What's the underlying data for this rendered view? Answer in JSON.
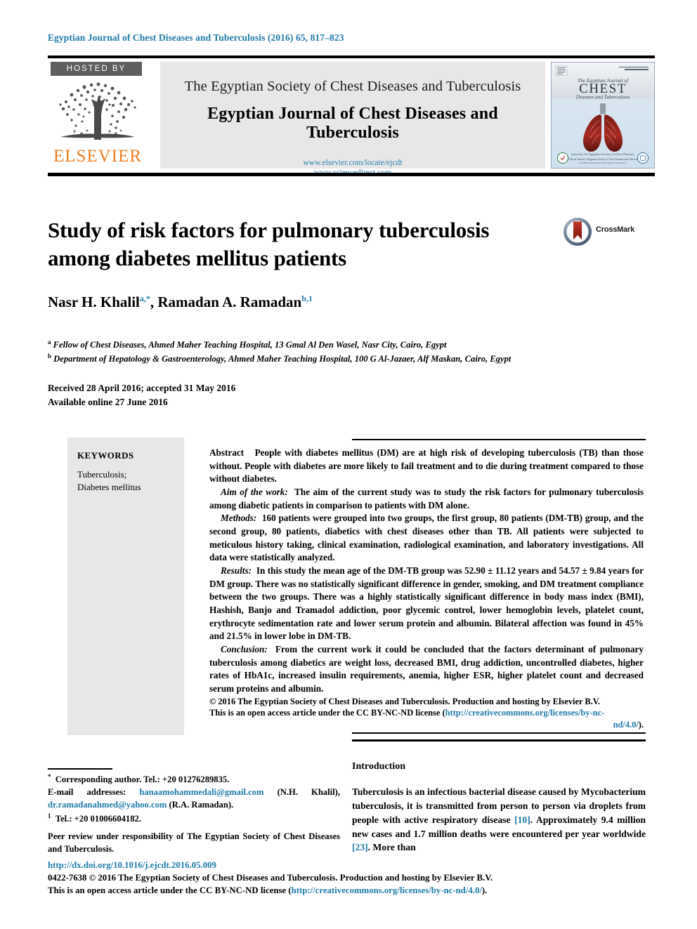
{
  "running_head": "Egyptian Journal of Chest Diseases and Tuberculosis (2016) 65, 817–823",
  "masthead": {
    "hosted_by_label": "HOSTED BY",
    "publisher_name": "ELSEVIER",
    "society_line": "The Egyptian Society of Chest Diseases and Tuberculosis",
    "journal_title": "Egyptian Journal of Chest Diseases and Tuberculosis",
    "url_elsevier": "www.elsevier.com/locate/ejcdt",
    "url_sciencedirect": "www.sciencedirect.com",
    "cover": {
      "top_right_label": "Egyptian Journal of Chest Diseases and Tuberculosis",
      "line1": "The Egyptian Journal of",
      "line2": "CHEST",
      "line3": "Diseases and Tuberculosis",
      "footer1": "Issued by the Egyptian Society of Chest Diseases and Tuberculosis",
      "footer2": "The Official Journal of Egyptian Society of Chest Diseases and Tuberculosis",
      "footer3": "An Official Journal of Arab Thoracic Association"
    }
  },
  "article": {
    "title": "Study of risk factors for pulmonary tuberculosis among diabetes mellitus patients",
    "crossmark_label": "CrossMark",
    "authors_html": "Nasr H. Khalil<sup>a,*</sup>, Ramadan A. Ramadan<sup>b,1</sup>",
    "affiliation_a": "Fellow of Chest Diseases, Ahmed Maher Teaching Hospital, 13 Gmal Al Den Wasel, Nasr City, Cairo, Egypt",
    "affiliation_b": "Department of Hepatology & Gastroenterology, Ahmed Maher Teaching Hospital, 100 G Al-Jazaer, Alf Maskan, Cairo, Egypt",
    "received_line": "Received 28 April 2016; accepted 31 May 2016",
    "available_line": "Available online 27 June 2016"
  },
  "keywords": {
    "heading": "KEYWORDS",
    "items_text": "Tuberculosis;\nDiabetes mellitus"
  },
  "abstract": {
    "label": "Abstract",
    "lead": "People with diabetes mellitus (DM) are at high risk of developing tuberculosis (TB) than those without. People with diabetes are more likely to fail treatment and to die during treatment compared to those without diabetes.",
    "aim_label": "Aim of the work:",
    "aim_text": "The aim of the current study was to study the risk factors for pulmonary tuberculosis among diabetic patients in comparison to patients with DM alone.",
    "methods_label": "Methods:",
    "methods_text": "160 patients were grouped into two groups, the first group, 80 patients (DM-TB) group, and the second group, 80 patients, diabetics with chest diseases other than TB. All patients were subjected to meticulous history taking, clinical examination, radiological examination, and laboratory investigations. All data were statistically analyzed.",
    "results_label": "Results:",
    "results_text": "In this study the mean age of the DM-TB group was 52.90 ± 11.12 years and 54.57 ± 9.84 years for DM group. There was no statistically significant difference in gender, smoking, and DM treatment compliance between the two groups. There was a highly statistically significant difference in body mass index (BMI), Hashish, Banjo and Tramadol addiction, poor glycemic control, lower hemoglobin levels, platelet count, erythrocyte sedimentation rate and lower serum protein and albumin. Bilateral affection was found in 45% and 21.5% in lower lobe in DM-TB.",
    "conclusion_label": "Conclusion:",
    "conclusion_text": "From the current work it could be concluded that the factors determinant of pulmonary tuberculosis among diabetics are weight loss, decreased BMI, drug addiction, uncontrolled diabetes, higher rates of HbA1c, increased insulin requirements, anemia, higher ESR, higher platelet count and decreased serum proteins and albumin.",
    "copyright_line": "© 2016 The Egyptian Society of Chest Diseases and Tuberculosis. Production and hosting by Elsevier B.V.",
    "license_prefix": "This is an open access article under the CC BY-NC-ND license (",
    "license_url_part1": "http://creativecommons.org/licenses/by-nc-",
    "license_url_part2": "nd/4.0/",
    "license_suffix": ")."
  },
  "footnotes": {
    "corresponding": "Corresponding author. Tel.: +20 01276289835.",
    "email_label": "E-mail addresses:",
    "email_1": "hanaamohammedali@gmail.com",
    "email_1_owner": "(N.H. Khalil),",
    "email_2": "dr.ramadanahmed@yahoo.com",
    "email_2_owner": "(R.A. Ramadan).",
    "tel_2": "Tel.: +20 01006604182.",
    "peer_review": "Peer review under responsibility of The Egyptian Society of Chest Diseases and Tuberculosis.",
    "marker_star": "*",
    "marker_one": "1"
  },
  "introduction": {
    "heading": "Introduction",
    "paragraph": "Tuberculosis is an infectious bacterial disease caused by Mycobacterium tuberculosis, it is transmitted from person to person via droplets from people with active respiratory disease [10]. Approximately 9.4 million new cases and 1.7 million deaths were encountered per year worldwide [23]. More than",
    "ref_1": "[10]",
    "ref_2": "[23]"
  },
  "bottom": {
    "doi": "http://dx.doi.org/10.1016/j.ejcdt.2016.05.009",
    "issn_line": "0422-7638 © 2016 The Egyptian Society of Chest Diseases and Tuberculosis. Production and hosting by Elsevier B.V.",
    "license_prefix": "This is an open access article under the CC BY-NC-ND license (",
    "license_url": "http://creativecommons.org/licenses/by-nc-nd/4.0/",
    "license_suffix": ")."
  },
  "colors": {
    "link_blue": "#1f7ba8",
    "elsevier_orange": "#f07c1f",
    "band_gray": "#e7e7e7",
    "hosted_gray": "#5e5e5e"
  }
}
